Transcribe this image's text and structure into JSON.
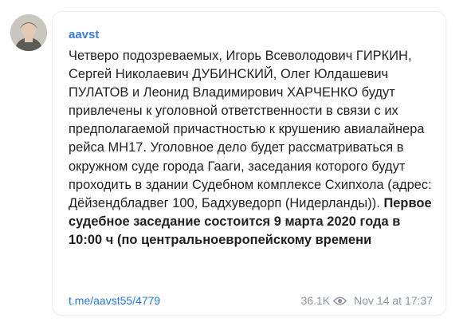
{
  "post": {
    "author": "aavst",
    "text_plain": "Четверо подозреваемых, Игорь Всеволодович ГИРКИН, Сергей Николаевич ДУБИНСКИЙ, Олег Юлдашевич ПУЛАТОВ и Леонид Владимирович ХАРЧЕНКО будут привлечены к уголовной ответственности в связи с их предполагаемой причастностью к крушению авиалайнера рейса MH17. Уголовное дело будет рассматриваться в окружном суде города Гааги, заседания которого будут проходить в здании Судебном комплексе Схипхола (адрес: Дёйзендбладвег 100, Бадхуведорп (Нидерланды)).",
    "text_bold": "Первое судебное заседание состоится 9 марта 2020 года в 10:00 ч (по центральноевропейскому времени",
    "link": "t.me/aavst55/4779",
    "views": "36.1K",
    "date": "Nov 14 at 17:37"
  },
  "icons": {
    "avatar": "channel-avatar-photo",
    "views": "eye-icon"
  },
  "colors": {
    "author": "#3a7bd5",
    "link": "#2a7ad8",
    "meta": "#8c969f",
    "text": "#1f1f1f"
  }
}
